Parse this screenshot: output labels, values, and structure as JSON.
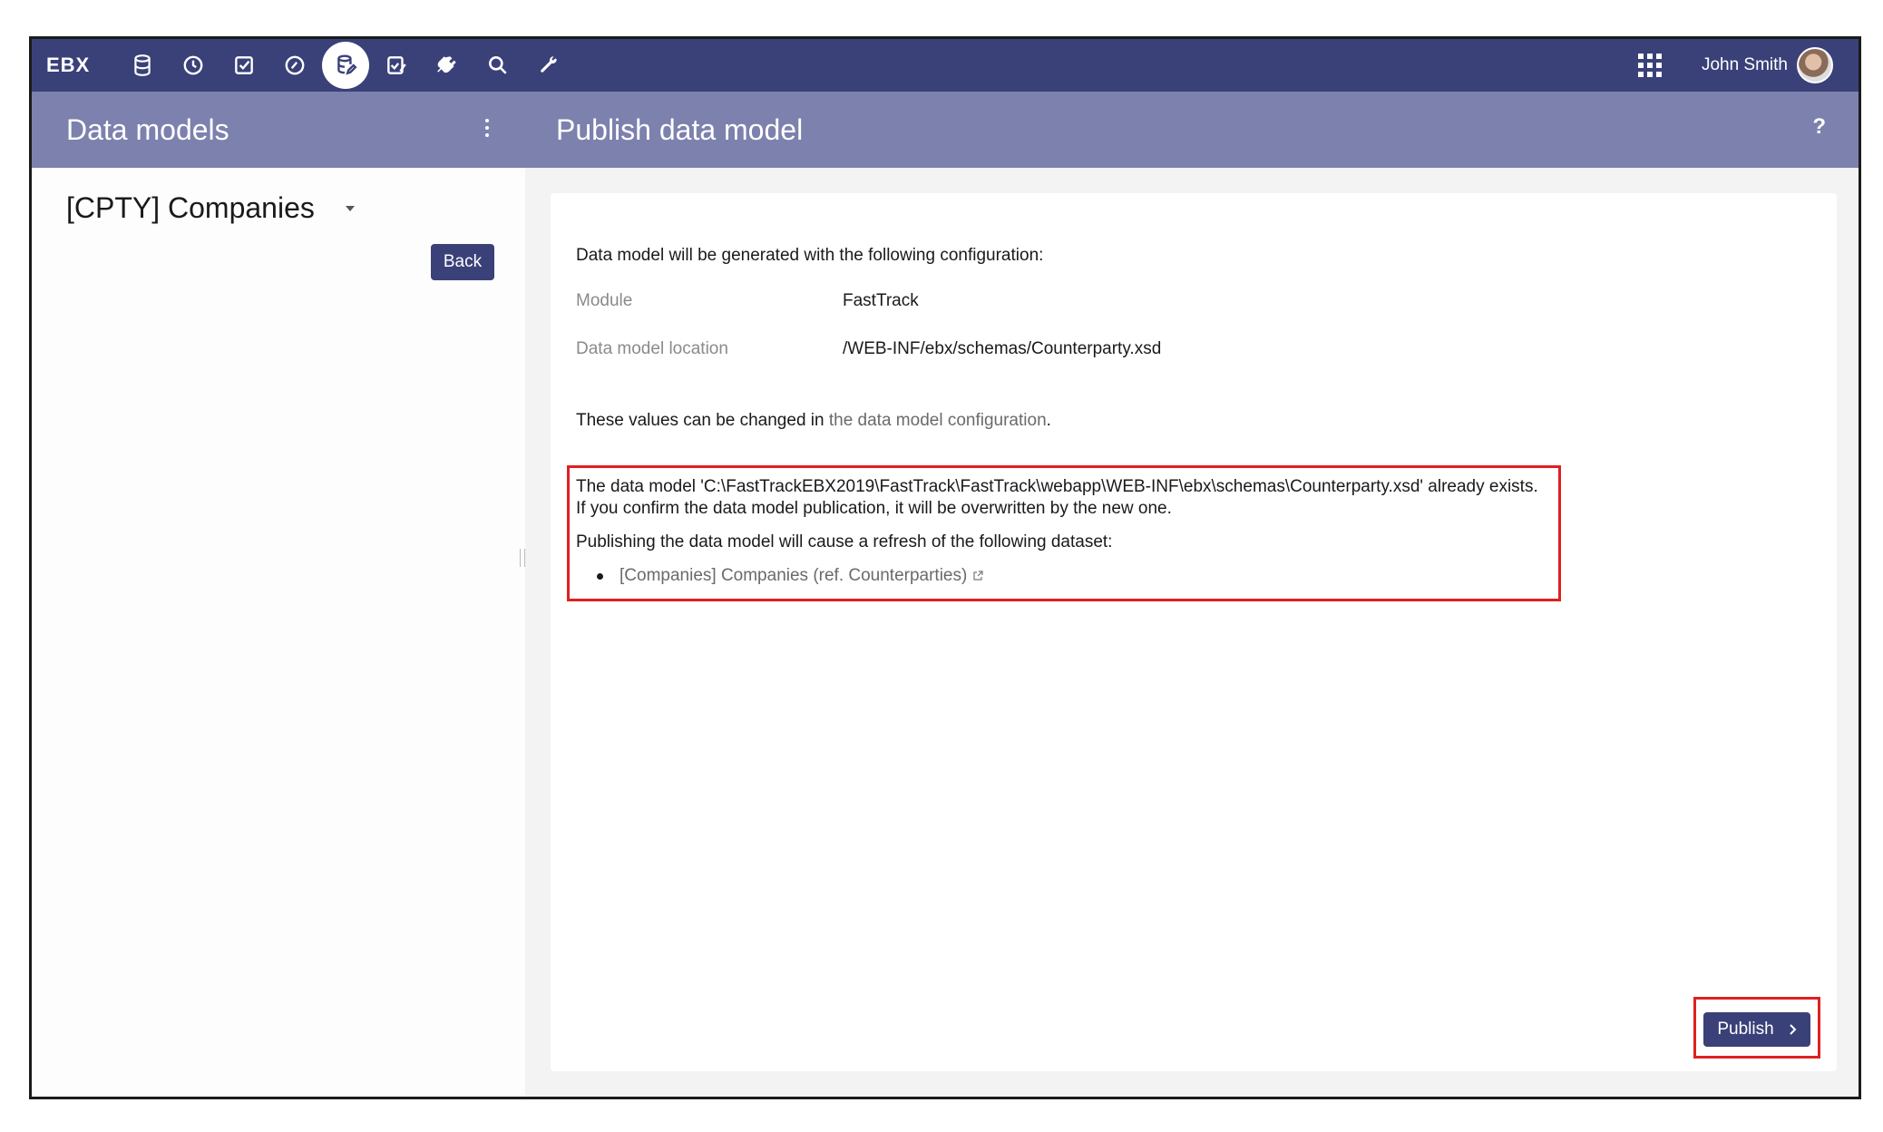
{
  "app": {
    "brand": "EBX"
  },
  "topbar": {
    "icons": [
      "database-icon",
      "clock-icon",
      "checkbox-icon",
      "gauge-icon",
      "data-model-icon",
      "edit-check-icon",
      "plug-icon",
      "search-icon",
      "wrench-icon"
    ],
    "user_name": "John Smith"
  },
  "left": {
    "section_title": "Data models",
    "selected_model": "[CPTY] Companies",
    "back_label": "Back"
  },
  "main": {
    "page_title": "Publish data model",
    "help_label": "?",
    "intro": "Data model will be generated with the following configuration:",
    "config": [
      {
        "label": "Module",
        "value": "FastTrack"
      },
      {
        "label": "Data model location",
        "value": "/WEB-INF/ebx/schemas/Counterparty.xsd"
      }
    ],
    "change_prefix": "These values can be changed in ",
    "change_link": "the data model configuration",
    "change_suffix": ".",
    "warning": {
      "line1": "The data model 'C:\\FastTrackEBX2019\\FastTrack\\FastTrack\\webapp\\WEB-INF\\ebx\\schemas\\Counterparty.xsd' already exists.",
      "line2": "If you confirm the data model publication, it will be overwritten by the new one.",
      "line3": "Publishing the data model will cause a refresh of the following dataset:",
      "dataset": "[Companies] Companies (ref. Counterparties)"
    },
    "publish_label": "Publish"
  },
  "colors": {
    "topbar": "#3a4179",
    "subheader": "#7c81ad",
    "highlight": "#e02020"
  }
}
